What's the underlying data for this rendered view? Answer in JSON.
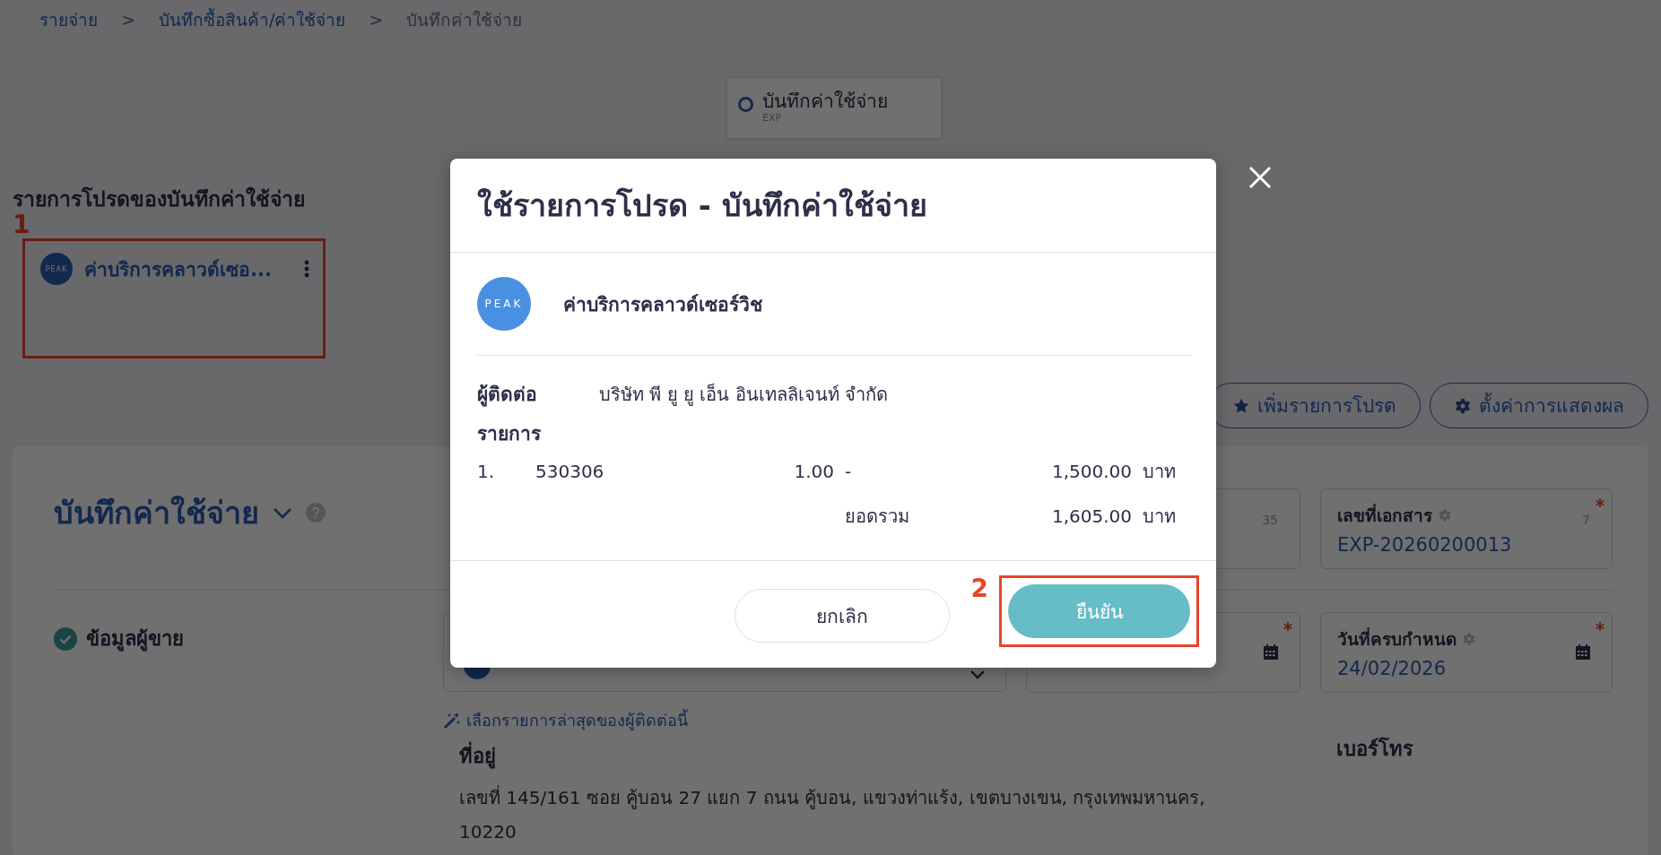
{
  "breadcrumb": [
    {
      "kind": "link",
      "label": "รายจ่าย"
    },
    {
      "kind": "separator",
      "label": ">"
    },
    {
      "kind": "link",
      "label": "บันทึกซื้อสินค้า/ค่าใช้จ่าย"
    },
    {
      "kind": "separator",
      "label": ">"
    },
    {
      "kind": "current",
      "label": "บันทึกค่าใช้จ่าย"
    }
  ],
  "steps": [
    {
      "label": "บันทึกค่าใช้จ่าย",
      "code": "EXP",
      "selected": true
    }
  ],
  "favorites": {
    "title": "รายการโปรดของบันทึกค่าใช้จ่าย",
    "items": [
      {
        "logo": "PEAK",
        "name": "ค่าบริการคลาวด์เซอ..."
      }
    ]
  },
  "toolbar_buttons": [
    {
      "kind": "star",
      "label": "เพิ่มรายการโปรด"
    },
    {
      "kind": "gear",
      "label": "ตั้งค่าการแสดงผล"
    }
  ],
  "document": {
    "title": "บันทึกค่าใช้จ่าย",
    "header_fields": [
      {
        "counter": "35",
        "required": false
      },
      {
        "label": "เลขที่เอกสาร",
        "counter": "7",
        "required": true,
        "value": "EXP-20260200013"
      }
    ],
    "vendor": {
      "section": "ข้อมูลผู้ขาย",
      "done": true,
      "recent_link": "เลือกรายการล่าสุดของผู้ติดต่อนี้",
      "address_label": "ที่อยู่",
      "address": "เลขที่ 145/161 ซอย คู้บอน 27 แยก 7 ถนน คู้บอน, แขวงท่าแร้ง, เขตบางเขน, กรุงเทพมหานคร, 10220",
      "phone_label": "เบอร์โทร"
    },
    "date_fields": [
      {
        "required": true
      },
      {
        "label": "วันที่ครบกำหนด",
        "value": "24/02/2026",
        "required": true
      }
    ]
  },
  "modal": {
    "title": "ใช้รายการโปรด - บันทึกค่าใช้จ่าย",
    "favorite": {
      "logo": "PEAK",
      "name": "ค่าบริการคลาวด์เซอร์วิช"
    },
    "contact_label": "ผู้ติดต่อ",
    "contact": "บริษัท พี ยู ยู เอ็น อินเทลลิเจนท์ จำกัด",
    "items_label": "รายการ",
    "items": [
      {
        "no": "1.",
        "code": "530306",
        "qty": "1.00",
        "note": "-",
        "amount": "1,500.00",
        "unit": "บาท"
      }
    ],
    "total": {
      "label": "ยอดรวม",
      "amount": "1,605.00",
      "unit": "บาท"
    },
    "buttons": [
      {
        "kind": "secondary",
        "label": "ยกเลิก"
      },
      {
        "kind": "primary",
        "label": "ยืนยัน"
      }
    ]
  },
  "annotations": [
    {
      "label": "1"
    },
    {
      "label": "2"
    }
  ]
}
